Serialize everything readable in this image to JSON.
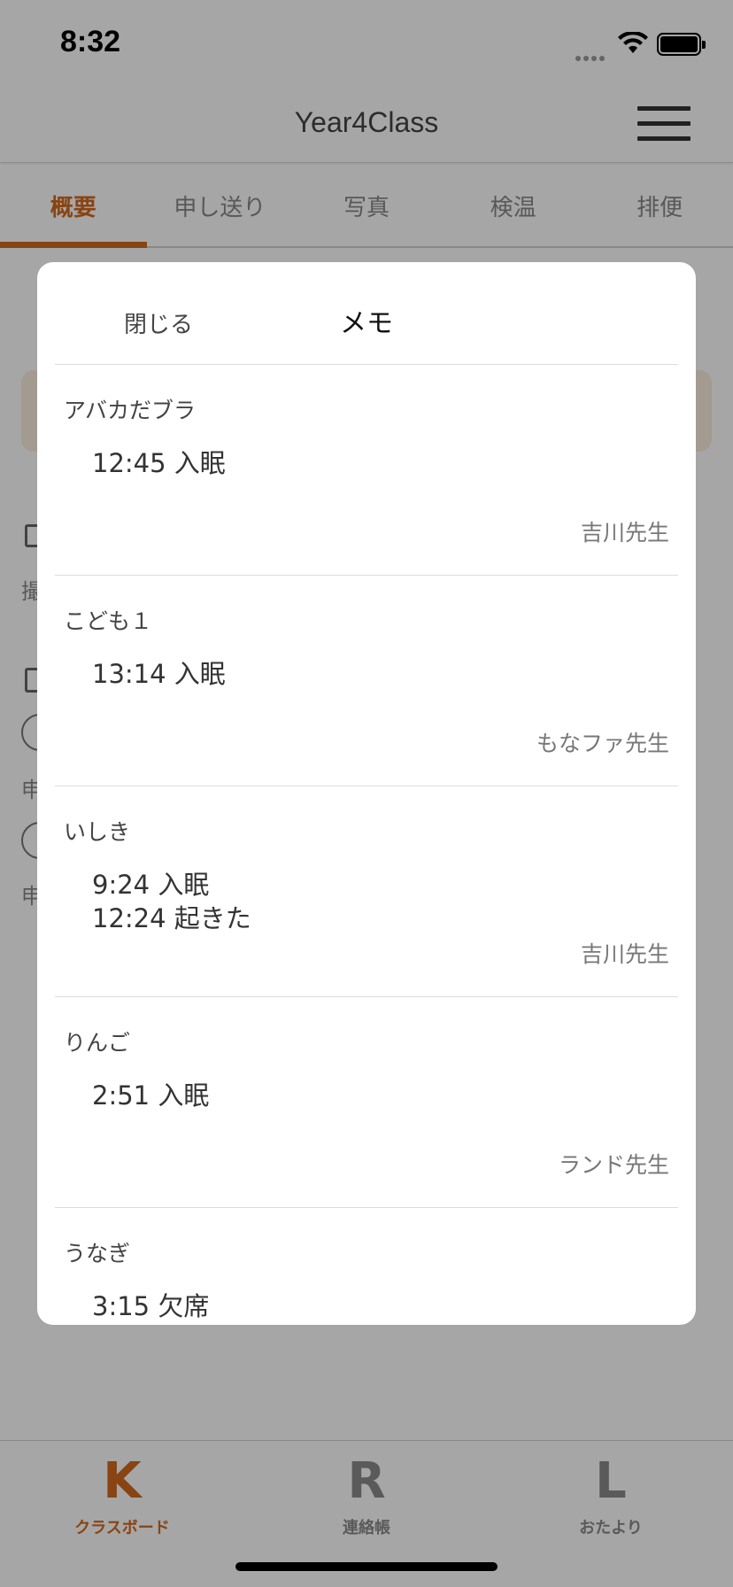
{
  "status": {
    "time": "8:32"
  },
  "navbar": {
    "title": "Year4Class"
  },
  "tabs": [
    {
      "label": "概要",
      "active": true
    },
    {
      "label": "申し送り",
      "active": false
    },
    {
      "label": "写真",
      "active": false
    },
    {
      "label": "検温",
      "active": false
    },
    {
      "label": "排便",
      "active": false
    }
  ],
  "background": {
    "text_a": "撮",
    "text_b": "申",
    "text_c": "申"
  },
  "modal": {
    "close_label": "閉じる",
    "title": "メモ",
    "memos": [
      {
        "child": "アバカだブラ",
        "lines": [
          "12:45 入眠"
        ],
        "teacher": "吉川先生"
      },
      {
        "child": "こども１",
        "lines": [
          "13:14 入眠"
        ],
        "teacher": "もなファ先生"
      },
      {
        "child": "いしき",
        "lines": [
          "9:24 入眠",
          "12:24 起きた"
        ],
        "teacher": "吉川先生"
      },
      {
        "child": "りんご",
        "lines": [
          "2:51 入眠"
        ],
        "teacher": "ランド先生"
      },
      {
        "child": "うなぎ",
        "lines": [
          "3:15 欠席"
        ],
        "teacher": ""
      }
    ]
  },
  "tabbar": {
    "items": [
      {
        "glyph": "K",
        "label": "クラスボード",
        "active": true
      },
      {
        "glyph": "R",
        "label": "連絡帳",
        "active": false
      },
      {
        "glyph": "L",
        "label": "おたより",
        "active": false
      }
    ]
  },
  "colors": {
    "accent": "#d2691e"
  }
}
